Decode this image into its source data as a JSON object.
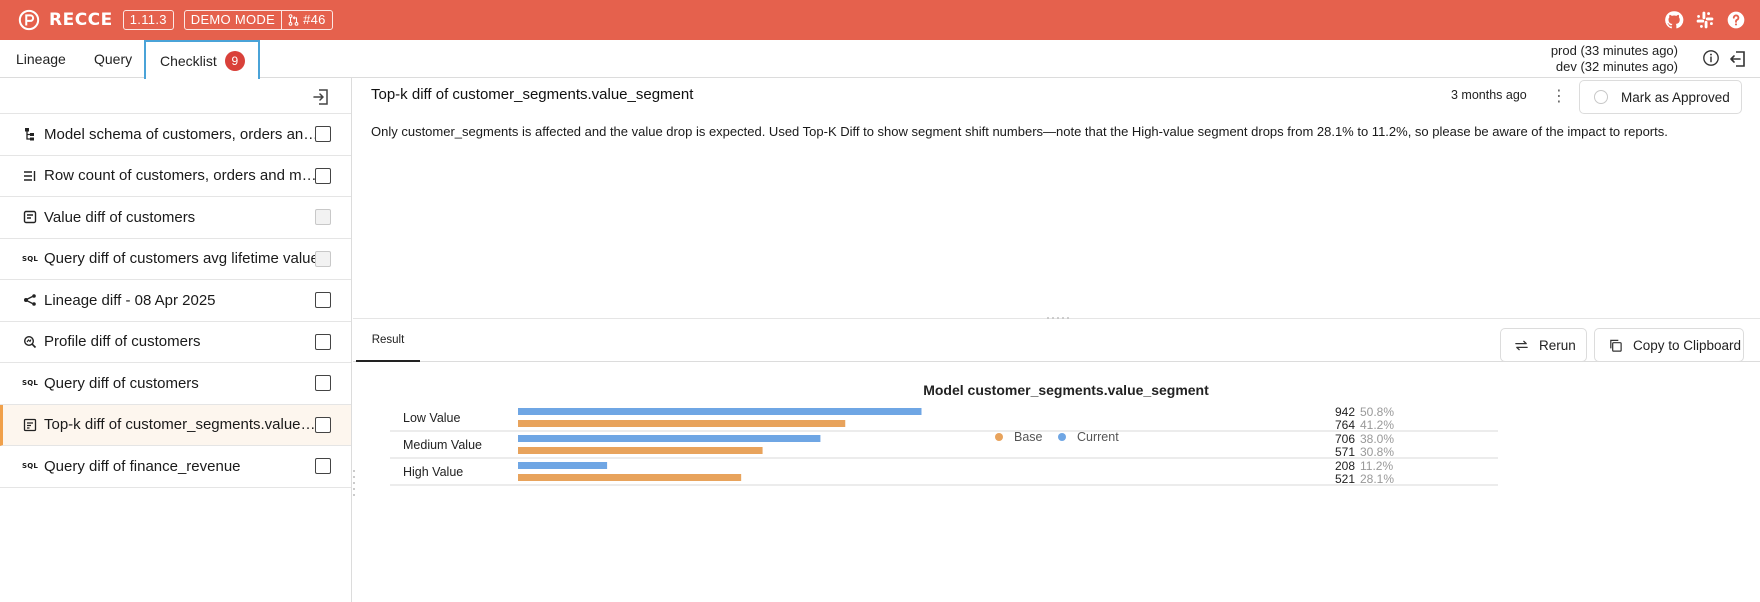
{
  "app": {
    "name": "RECCE",
    "version": "1.11.3",
    "mode": "DEMO MODE",
    "pr": "#46",
    "brand_color": "#e5614d"
  },
  "tabs": [
    {
      "label": "Lineage"
    },
    {
      "label": "Query"
    },
    {
      "label": "Checklist",
      "badge": "9",
      "active": true
    }
  ],
  "env": {
    "prod": "prod (33 minutes ago)",
    "dev": "dev (32 minutes ago)"
  },
  "checklist": [
    {
      "icon": "schema-icon",
      "label": "Model schema of customers, orders and modified nodes",
      "checked": false,
      "disabled": false
    },
    {
      "icon": "row-count-icon",
      "label": "Row count of customers, orders and modified nodes",
      "checked": false,
      "disabled": false
    },
    {
      "icon": "value-diff-icon",
      "label": "Value diff of customers",
      "checked": false,
      "disabled": true
    },
    {
      "icon": "sql-icon",
      "label": "Query diff of customers avg lifetime value",
      "checked": false,
      "disabled": true
    },
    {
      "icon": "lineage-diff-icon",
      "label": "Lineage diff - 08 Apr 2025",
      "checked": false,
      "disabled": false
    },
    {
      "icon": "profile-diff-icon",
      "label": "Profile diff of customers",
      "checked": false,
      "disabled": false
    },
    {
      "icon": "sql-icon",
      "label": "Query diff of customers",
      "checked": false,
      "disabled": false
    },
    {
      "icon": "top-k-icon",
      "label": "Top-k diff of customer_segments.value_segment",
      "checked": false,
      "disabled": false,
      "selected": true
    },
    {
      "icon": "sql-icon",
      "label": "Query diff of finance_revenue",
      "checked": false,
      "disabled": false
    }
  ],
  "check": {
    "title": "Top-k diff of customer_segments.value_segment",
    "time_ago": "3 months ago",
    "approve_label": "Mark as Approved",
    "description": "Only customer_segments is affected and the value drop is expected. Used Top-K Diff to show segment shift numbers—note that the High-value segment drops from 28.1% to 11.2%, so please be aware of the impact to reports."
  },
  "result": {
    "tab_label": "Result",
    "rerun_label": "Rerun",
    "copy_label": "Copy to Clipboard"
  },
  "chart_data": {
    "type": "bar",
    "title": "Model customer_segments.value_segment",
    "legend": [
      "Base",
      "Current"
    ],
    "legend_position": "top-center",
    "colors": {
      "Base": "#e8a35c",
      "Current": "#6fa6e4"
    },
    "categories": [
      "Low Value",
      "Medium Value",
      "High Value"
    ],
    "series": [
      {
        "name": "Current",
        "values": [
          942,
          706,
          208
        ],
        "percents": [
          "50.8%",
          "38.0%",
          "11.2%"
        ]
      },
      {
        "name": "Base",
        "values": [
          764,
          571,
          521
        ],
        "percents": [
          "41.2%",
          "30.8%",
          "28.1%"
        ]
      }
    ],
    "xlim": [
      0,
      1856
    ]
  }
}
